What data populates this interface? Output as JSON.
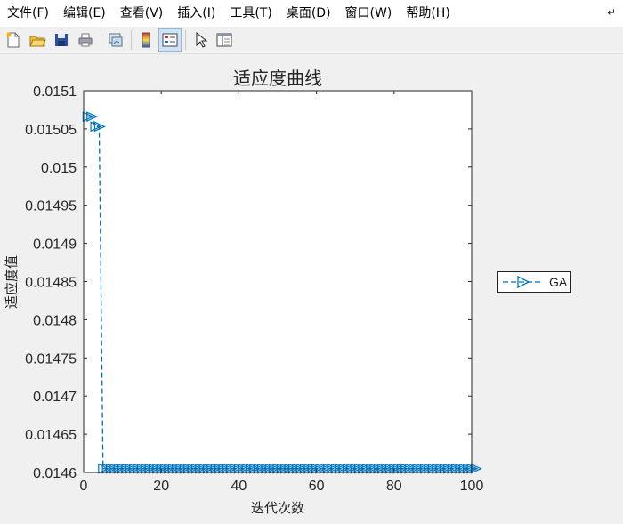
{
  "menu": {
    "items": [
      "文件(F)",
      "编辑(E)",
      "查看(V)",
      "插入(I)",
      "工具(T)",
      "桌面(D)",
      "窗口(W)",
      "帮助(H)"
    ],
    "overflow_icon": "dock-arrow-icon"
  },
  "toolbar": {
    "buttons": [
      "new-figure-icon",
      "open-file-icon",
      "save-icon",
      "print-icon",
      "link-plot-icon",
      "colorbar-icon",
      "legend-icon",
      "pointer-icon",
      "property-editor-icon"
    ],
    "active": "legend-icon"
  },
  "chart_data": {
    "type": "line",
    "title": "适应度曲线",
    "xlabel": "迭代次数",
    "ylabel": "适应度值",
    "xlim": [
      0,
      100
    ],
    "ylim": [
      0.0146,
      0.0151
    ],
    "xticks": [
      "0",
      "20",
      "40",
      "60",
      "80",
      "100"
    ],
    "yticks": [
      "0.0146",
      "0.01465",
      "0.0147",
      "0.01475",
      "0.0148",
      "0.01485",
      "0.0149",
      "0.01495",
      "0.015",
      "0.01505",
      "0.0151"
    ],
    "grid": false,
    "legend_position": "outside-right",
    "series": [
      {
        "name": "GA",
        "color": "#0072bd",
        "line_style": "dashed",
        "marker": "triangle-right",
        "x_start": 1,
        "x_end": 101,
        "segments": [
          {
            "from": 1,
            "to": 2,
            "value": 0.015066
          },
          {
            "from": 3,
            "to": 4,
            "value": 0.015053
          },
          {
            "from": 5,
            "to": 101,
            "value": 0.014605
          }
        ]
      }
    ]
  }
}
